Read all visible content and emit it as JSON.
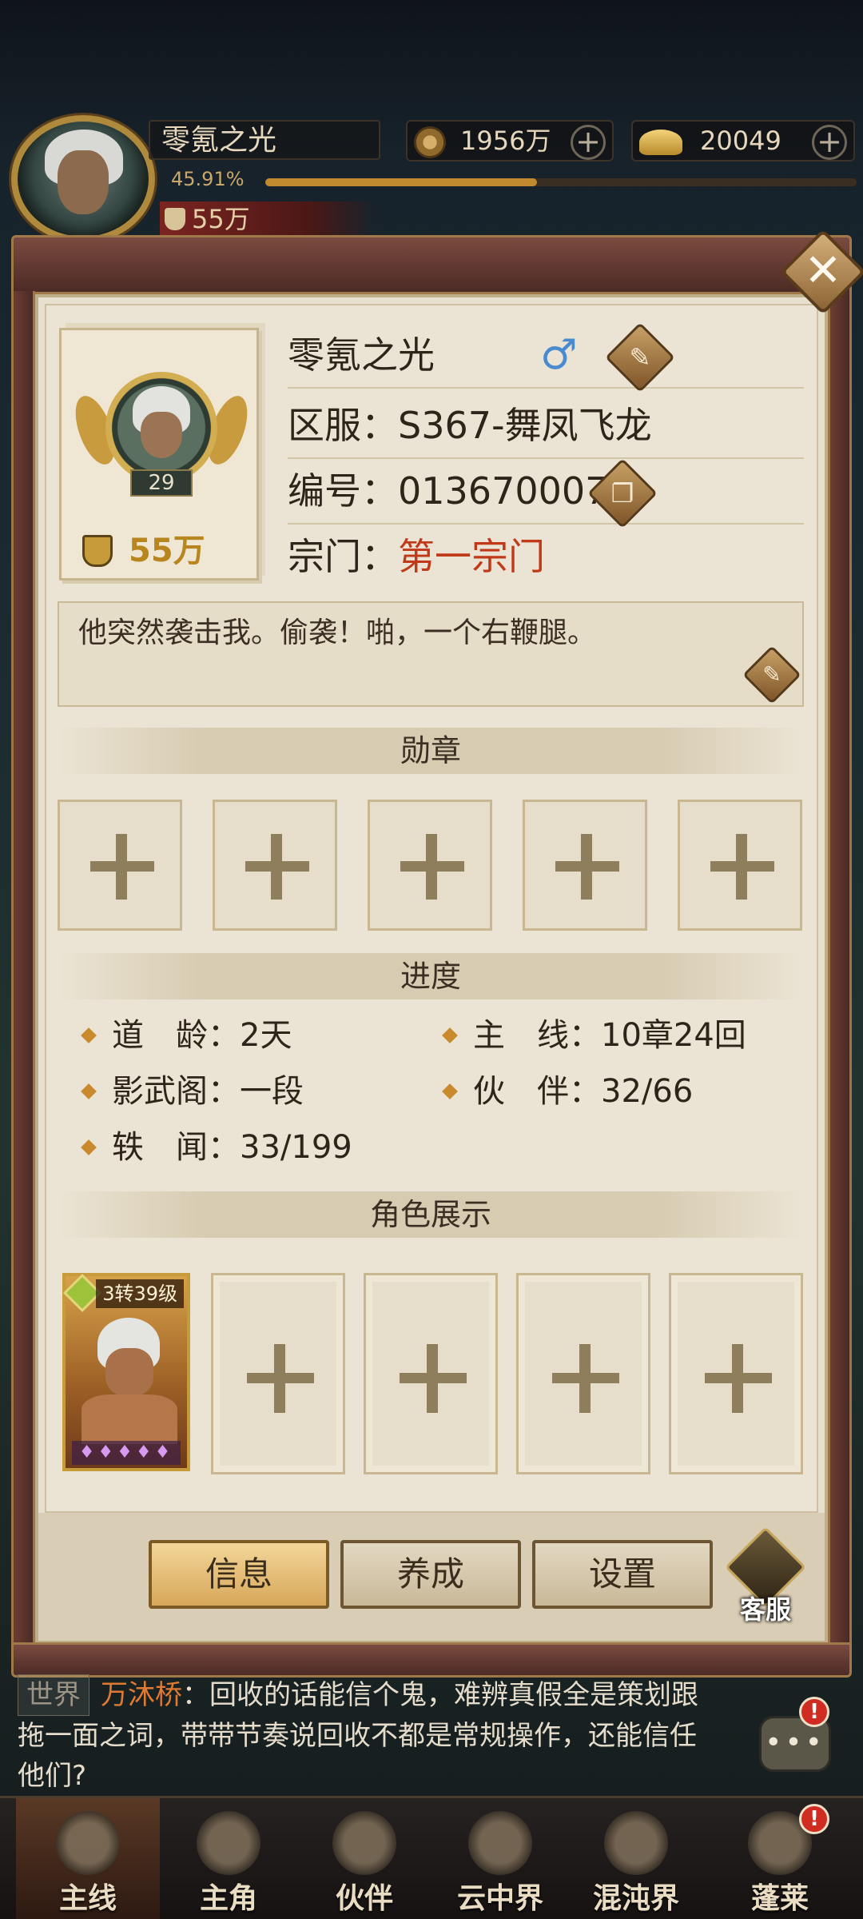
{
  "hud": {
    "player_name": "零氪之光",
    "exp_percent_text": "45.91%",
    "exp_fraction": 0.4591,
    "power": "55万",
    "copper": "1956万",
    "gold": "20049"
  },
  "profile": {
    "name": "零氪之光",
    "server_label": "区服：",
    "server_value": "S367-舞凤飞龙",
    "id_label": "编号：",
    "id_value": "013670007",
    "sect_label": "宗门：",
    "sect_value": "第一宗门",
    "level": "29",
    "power": "55万",
    "signature": "他突然袭击我。偷袭！啪，一个右鞭腿。",
    "gender_symbol": "♂"
  },
  "sections": {
    "medals": "勋章",
    "progress": "进度",
    "showcase": "角色展示"
  },
  "progress": {
    "dao_age_label": "道　龄：",
    "dao_age_value": "2天",
    "main_line_label": "主　线：",
    "main_line_value": "10章24回",
    "shadow_label": "影武阁：",
    "shadow_value": "一段",
    "partner_label": "伙　伴：",
    "partner_value": "32/66",
    "rumor_label": "轶　闻：",
    "rumor_value": "33/199"
  },
  "showcase": {
    "card_tag": "3转39级"
  },
  "tabs": {
    "info": "信息",
    "develop": "养成",
    "settings": "设置",
    "service": "客服"
  },
  "chat": {
    "channel": "世界",
    "speaker": "万沐桥",
    "message": "：回收的话能信个鬼，难辨真假全是策划跟拖一面之词，带带节奏说回收不都是常规操作，还能信任他们?"
  },
  "nav": {
    "items": [
      "主线",
      "主角",
      "伙伴",
      "云中界",
      "混沌界",
      "蓬莱"
    ]
  },
  "colors": {
    "accent_red": "#c03a1a",
    "gold": "#b8861e",
    "panel_bg": "#e8e0cf"
  }
}
